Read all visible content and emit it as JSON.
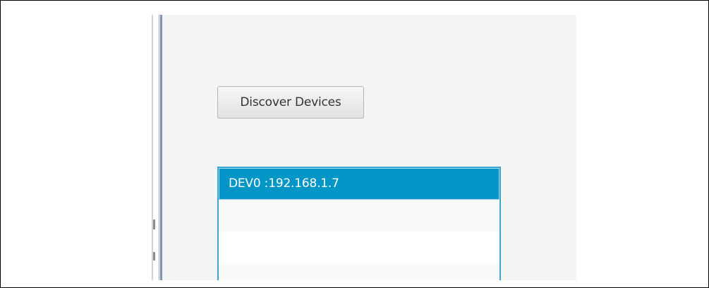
{
  "discover": {
    "label": "Discover Devices"
  },
  "devices": {
    "items": [
      {
        "label": "DEV0 :192.168.1.7",
        "selected": true
      },
      {
        "label": ""
      },
      {
        "label": ""
      },
      {
        "label": ""
      }
    ]
  },
  "colors": {
    "selection": "#0596c8",
    "list_border": "#3aa7d3",
    "panel_bg": "#f4f4f4"
  }
}
